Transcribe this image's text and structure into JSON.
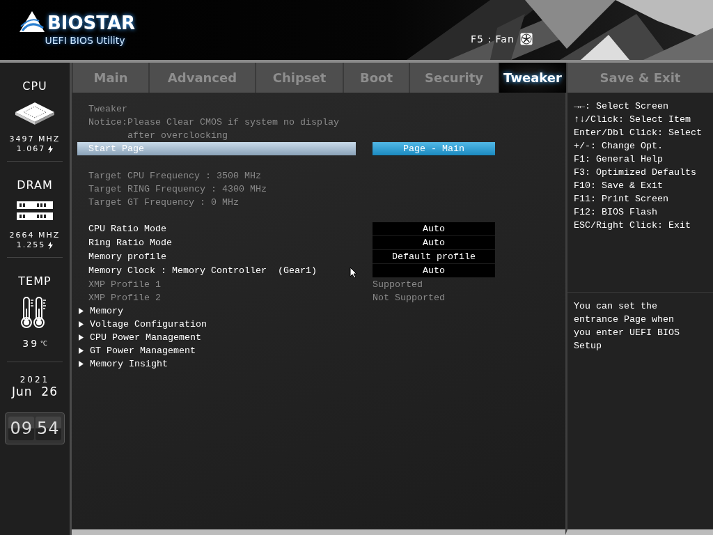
{
  "header": {
    "brand": "BIOSTAR",
    "subtitle": "UEFI BIOS Utility",
    "fan_shortcut": "F5 : Fan"
  },
  "sidebar": {
    "sections": [
      {
        "kind": "cpu",
        "title": "CPU",
        "frequency": "3497 MHZ",
        "voltage": "1.067"
      },
      {
        "kind": "dram",
        "title": "DRAM",
        "frequency": "2664 MHZ",
        "voltage": "1.255"
      },
      {
        "kind": "temp",
        "title": "TEMP",
        "reading": "39",
        "unit": "°C"
      },
      {
        "kind": "date",
        "year": "2021",
        "day": "Jun  26",
        "hours": "09",
        "minutes": "54"
      }
    ]
  },
  "tabs": [
    {
      "label": "Main",
      "selected": false
    },
    {
      "label": "Advanced",
      "selected": false
    },
    {
      "label": "Chipset",
      "selected": false
    },
    {
      "label": "Boot",
      "selected": false
    },
    {
      "label": "Security",
      "selected": false
    },
    {
      "label": "Tweaker",
      "selected": true
    },
    {
      "label": "Save & Exit",
      "selected": false
    }
  ],
  "settings": [
    {
      "rows": [
        {
          "kind": "info",
          "label": "Tweaker"
        },
        {
          "kind": "notice",
          "label": "Notice:Please Clear CMOS if system no display after overclocking"
        },
        {
          "kind": "setting",
          "label": "Start Page",
          "value": "Page - Main",
          "selected": true
        }
      ]
    },
    {
      "rows": [
        {
          "kind": "info",
          "label": "Target CPU Frequency : 3500 MHz"
        },
        {
          "kind": "info",
          "label": "Target RING Frequency : 4300 MHz"
        },
        {
          "kind": "info",
          "label": "Target GT Frequency : 0 MHz"
        }
      ]
    },
    {
      "rows": [
        {
          "kind": "setting",
          "label": "CPU Ratio Mode",
          "value": "Auto",
          "selected": false
        },
        {
          "kind": "setting",
          "label": "Ring Ratio Mode",
          "value": "Auto",
          "selected": false
        },
        {
          "kind": "setting",
          "label": "Memory profile",
          "value": "Default profile",
          "selected": false
        },
        {
          "kind": "setting",
          "label": "Memory Clock : Memory Controller  (Gear1)",
          "value": "Auto",
          "selected": false
        },
        {
          "kind": "readonly",
          "label": "XMP Profile 1",
          "value": "Supported"
        },
        {
          "kind": "readonly",
          "label": "XMP Profile 2",
          "value": "Not Supported"
        },
        {
          "kind": "submenu",
          "label": "Memory"
        },
        {
          "kind": "submenu",
          "label": "Voltage Configuration"
        },
        {
          "kind": "submenu",
          "label": "CPU Power Management"
        },
        {
          "kind": "submenu",
          "label": "GT Power Management"
        },
        {
          "kind": "submenu",
          "label": "Memory Insight"
        }
      ]
    }
  ],
  "help": {
    "keys": [
      "→←: Select Screen",
      "↑↓/Click: Select Item",
      "Enter/Dbl Click: Select",
      "+/-: Change Opt.",
      "F1: General Help",
      "F3: Optimized Defaults",
      "F10: Save & Exit",
      "F11: Print Screen",
      "F12: BIOS Flash",
      "ESC/Right Click: Exit"
    ],
    "description": "You can set the entrance Page when you enter UEFI BIOS Setup"
  }
}
